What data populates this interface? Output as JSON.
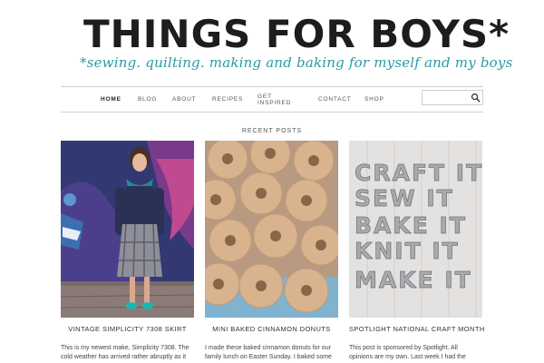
{
  "site": {
    "title": "THINGS FOR BOYS*",
    "tagline": "*sewing. quilting. making and baking for myself and my boys"
  },
  "nav": {
    "items": [
      {
        "label": "HOME",
        "active": true
      },
      {
        "label": "BLOG"
      },
      {
        "label": "ABOUT"
      },
      {
        "label": "RECIPES"
      },
      {
        "label": "GET INSPIRED"
      },
      {
        "label": "CONTACT"
      },
      {
        "label": "SHOP"
      }
    ],
    "search_placeholder": ""
  },
  "recent": {
    "heading": "RECENT POSTS",
    "posts": [
      {
        "title": "VINTAGE SIMPLICITY 7308 SKIRT",
        "excerpt": "This is my newest make, Simplicity 7308. The cold weather has arrived rather abruptly as it always does in Melbourne, so"
      },
      {
        "title": "MINI BAKED CINNAMON DONUTS",
        "excerpt": "I made these baked cinnamon donuts for our family lunch on Easter Sunday. I baked some"
      },
      {
        "title": "SPOTLIGHT NATIONAL CRAFT MONTH",
        "excerpt": "This post is sponsored by Spotlight. All opinions are my own. Last week I had the pleasure of"
      }
    ],
    "balloon_lines": [
      "CRAFT IT",
      "SEW IT",
      "BAKE IT",
      "KNIT IT",
      "MAKE IT"
    ]
  },
  "colors": {
    "accent": "#2a9aa8",
    "text": "#333333",
    "rule": "#cfcfcf"
  }
}
